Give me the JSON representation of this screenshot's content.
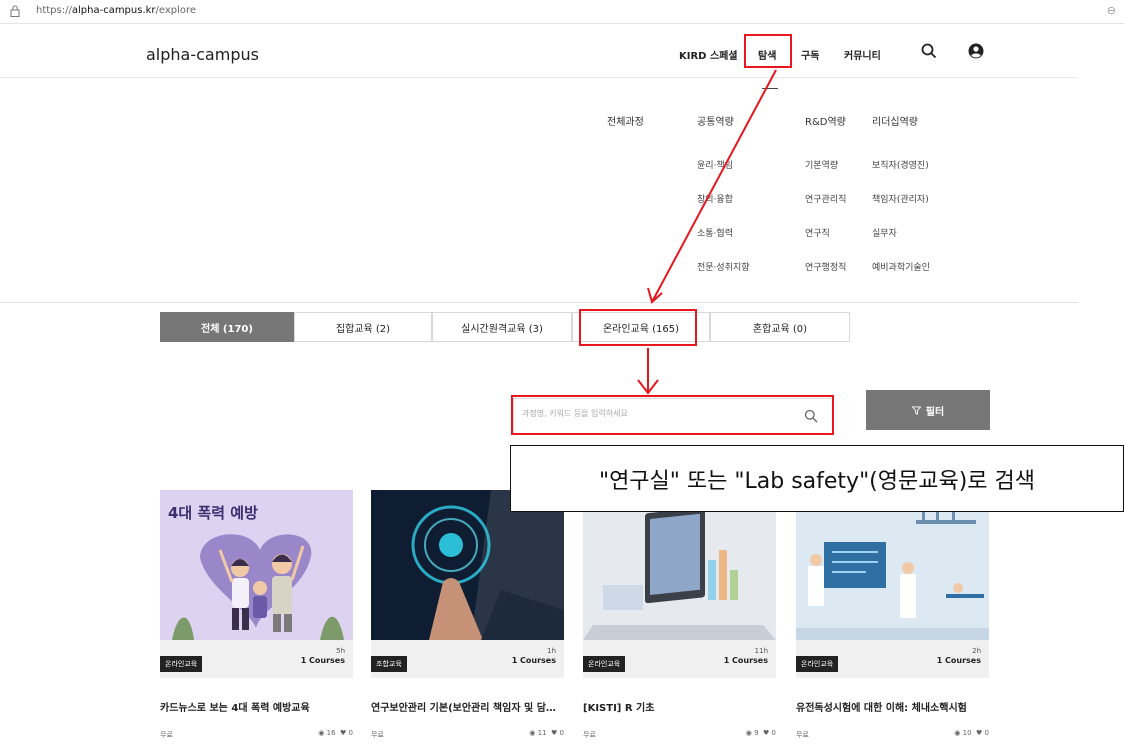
{
  "browser": {
    "url_prefix": "https://",
    "url_host": "alpha-campus.kr",
    "url_path": "/explore"
  },
  "header": {
    "logo": "alpha-campus",
    "nav": [
      "KIRD 스페셜",
      "탐색",
      "구독",
      "커뮤니티"
    ]
  },
  "menu": {
    "columns": [
      {
        "head": "전체과정",
        "items": []
      },
      {
        "head": "공통역량",
        "items": [
          "윤리·책임",
          "창의·융합",
          "소통·협력",
          "전문·성취지향"
        ]
      },
      {
        "head": "R&D역량",
        "items": [
          "기본역량",
          "연구관리직",
          "연구직",
          "연구행정직"
        ]
      },
      {
        "head": "리더십역량",
        "items": [
          "보직자(경영진)",
          "책임자(관리자)",
          "실무자",
          "예비과학기술인"
        ]
      }
    ]
  },
  "tabs": [
    "전체 (170)",
    "집합교육 (2)",
    "실시간원격교육 (3)",
    "온라인교육 (165)",
    "혼합교육 (0)"
  ],
  "search": {
    "placeholder": "과정명, 키워드 등을 입력하세요"
  },
  "filter": {
    "label": "필터"
  },
  "annotation": {
    "callout": "\"연구실\" 또는 \"Lab safety\"(영문교육)로 검색"
  },
  "cards": [
    {
      "thumb_text": "4대 폭력 예방",
      "badge": "온라인교육",
      "hours": "5h",
      "courses": "1 Courses",
      "title": "카드뉴스로 보는 4대 폭력 예방교육",
      "price": "무료",
      "views": "16",
      "likes": "0"
    },
    {
      "thumb_text": "",
      "badge": "조합교육",
      "hours": "1h",
      "courses": "1 Courses",
      "title": "연구보안관리 기본(보안관리 책임자 및 담…",
      "price": "무료",
      "views": "11",
      "likes": "0"
    },
    {
      "thumb_text": "",
      "badge": "온라인교육",
      "hours": "11h",
      "courses": "1 Courses",
      "title": "[KISTI] R 기초",
      "price": "무료",
      "views": "9",
      "likes": "0"
    },
    {
      "thumb_text": "",
      "badge": "온라인교육",
      "hours": "2h",
      "courses": "1 Courses",
      "title": "유전독성시험에 대한 이해: 체내소핵시험",
      "price": "무료",
      "views": "10",
      "likes": "0"
    }
  ],
  "colors": {
    "highlight": "#e8171d",
    "active_tab": "#777777"
  }
}
